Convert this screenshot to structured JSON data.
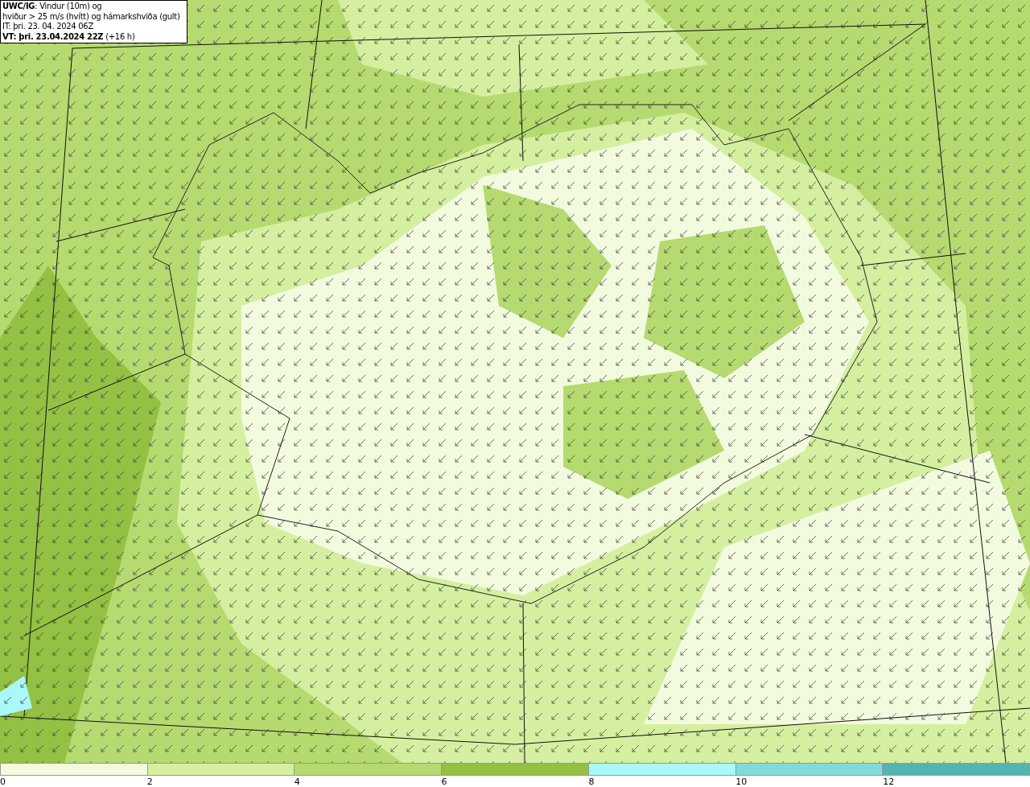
{
  "title_box": {
    "lines": [
      "**UWC/IG**: Vindur (10m) og",
      "hviður > 25 m/s (hvítt) og hámarkshviða (gult)",
      "IT: þri. 23. 04. 2024 06Z",
      "**VT: þri. 23.04.2024 22Z** (+16 h)"
    ]
  },
  "legend": {
    "segments": [
      {
        "color": "#f3fbdf"
      },
      {
        "color": "#d5efa0"
      },
      {
        "color": "#b5da70"
      },
      {
        "color": "#94c044"
      },
      {
        "color": "#aaf8f8"
      },
      {
        "color": "#82dbdb"
      },
      {
        "color": "#54b3b3"
      }
    ],
    "ticks": [
      "0",
      "2",
      "4",
      "6",
      "8",
      "10",
      "12"
    ]
  }
}
